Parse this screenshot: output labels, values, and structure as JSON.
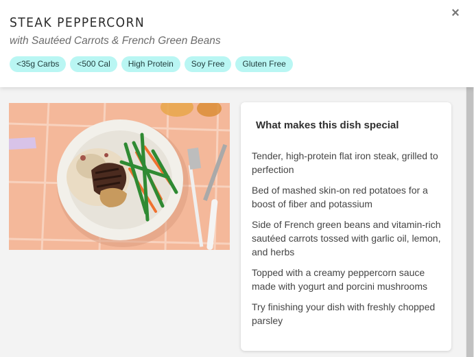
{
  "header": {
    "title": "STEAK PEPPERCORN",
    "subtitle": "with Sautéed Carrots & French Green Beans",
    "close_label": "×",
    "tags": [
      "<35g Carbs",
      "<500 Cal",
      "High Protein",
      "Soy Free",
      "Gluten Free"
    ]
  },
  "photo": {
    "alt": "Steak peppercorn dish photo"
  },
  "special": {
    "title": "What makes this dish special",
    "items": [
      "Tender, high-protein flat iron steak, grilled to perfection",
      "Bed of mashed skin-on red potatoes for a boost of fiber and potassium",
      "Side of French green beans and vitamin-rich sautéed carrots tossed with garlic oil, lemon, and herbs",
      "Topped with a creamy peppercorn sauce made with yogurt and porcini mushrooms",
      "Try finishing your dish with freshly chopped parsley"
    ]
  },
  "colors": {
    "tag_bg": "#b9f6f3",
    "photo_bg": "#f4b89a"
  }
}
